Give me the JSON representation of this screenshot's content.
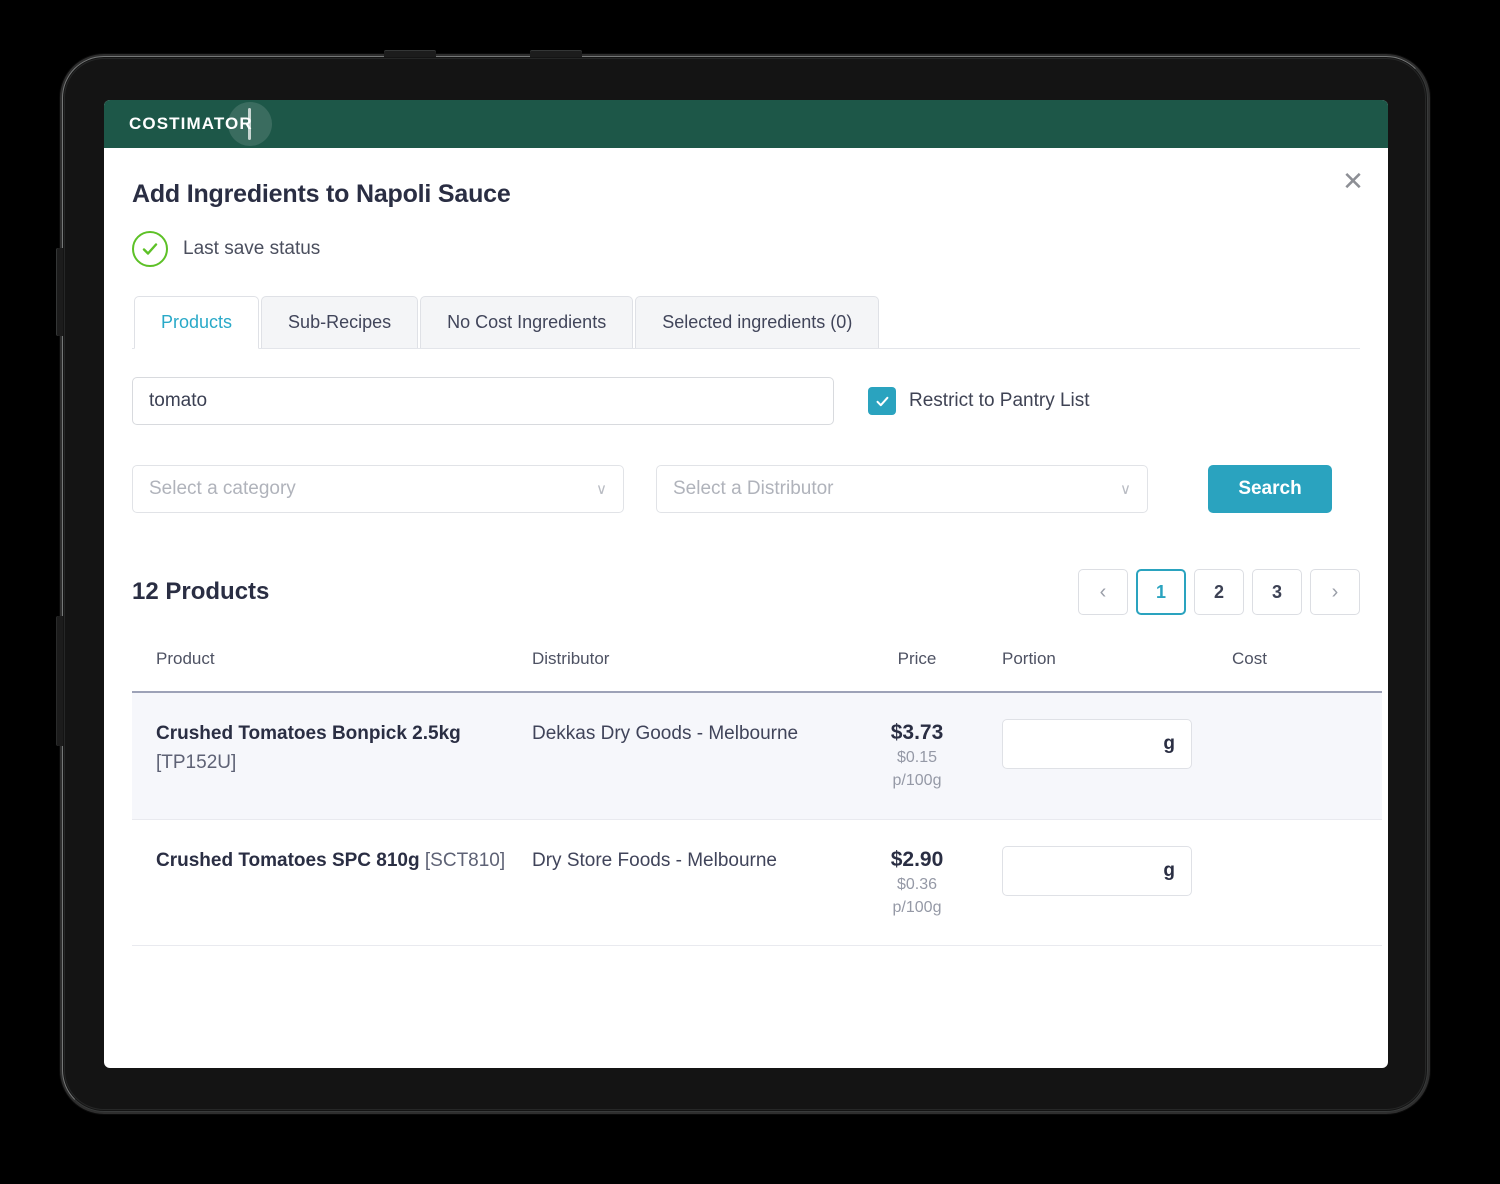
{
  "app": {
    "brand": "COSTIMATOR",
    "brand_color": "#1d5748",
    "accent_color": "#2aa3bf",
    "success_color": "#5dc127"
  },
  "modal": {
    "title": "Add Ingredients to Napoli Sauce",
    "close_label": "✕",
    "save_status": "Last save status"
  },
  "tabs": [
    {
      "label": "Products",
      "active": true
    },
    {
      "label": "Sub-Recipes",
      "active": false
    },
    {
      "label": "No Cost Ingredients",
      "active": false
    },
    {
      "label": "Selected ingredients (0)",
      "active": false
    }
  ],
  "search": {
    "value": "tomato",
    "placeholder": "",
    "pantry_label": "Restrict to Pantry List",
    "pantry_checked": true,
    "category_placeholder": "Select a category",
    "distributor_placeholder": "Select a Distributor",
    "search_button": "Search",
    "chevron": "∨"
  },
  "results": {
    "count_label": "12 Products",
    "pagination": {
      "prev": "‹",
      "next": "›",
      "pages": [
        "1",
        "2",
        "3"
      ],
      "current": "1"
    }
  },
  "table": {
    "headers": {
      "product": "Product",
      "distributor": "Distributor",
      "price": "Price",
      "portion": "Portion",
      "cost": "Cost"
    },
    "rows": [
      {
        "product_name": "Crushed Tomatoes Bonpick 2.5kg",
        "product_sku": "[TP152U]",
        "distributor": "Dekkas Dry Goods - Melbourne",
        "price": "$3.73",
        "price_unit_value": "$0.15",
        "price_unit_label": "p/100g",
        "portion_value": "",
        "portion_unit": "g",
        "cost": "",
        "highlighted": true
      },
      {
        "product_name": "Crushed Tomatoes SPC 810g",
        "product_sku": "[SCT810]",
        "distributor": "Dry Store Foods - Melbourne",
        "price": "$2.90",
        "price_unit_value": "$0.36",
        "price_unit_label": "p/100g",
        "portion_value": "",
        "portion_unit": "g",
        "cost": "",
        "highlighted": false
      }
    ]
  }
}
